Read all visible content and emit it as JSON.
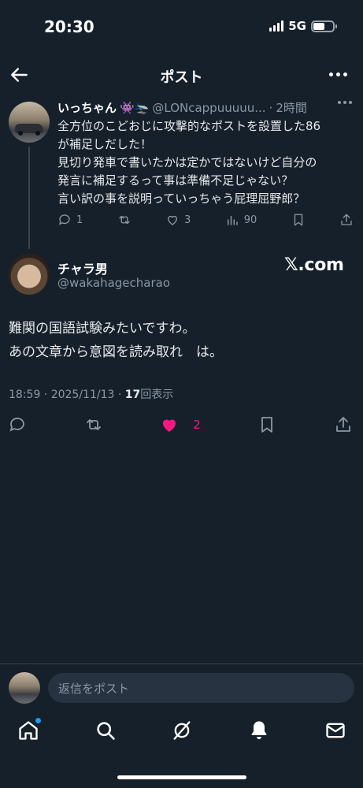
{
  "status_bar": {
    "time": "20:30",
    "network": "5G"
  },
  "header": {
    "title": "ポスト"
  },
  "parent_post": {
    "name": "いっちゃん",
    "name_emojis": "👾🛬",
    "handle": "@LONcappuuuuu...",
    "separator": "·",
    "time": "2時間",
    "lines": [
      "全方位のこどおじに攻撃的なポストを設置した86",
      "が補足しだした！",
      "見切り発車で書いたかは定かではないけど自分の",
      "発言に補足するって事は準備不足じゃない？",
      "言い訳の事を説明っていっちゃう屁理屈野郎？"
    ],
    "replies": "1",
    "likes": "3",
    "views": "90"
  },
  "main_post": {
    "name": "チャラ男",
    "handle": "@wakahagecharao",
    "watermark": "𝕏.com",
    "lines": [
      "難関の国語試験みたいですわ。",
      "あの文章から意図を読み取れ　は。"
    ],
    "timestamp": "18:59 · 2025/11/13 · ",
    "views_count": "17",
    "views_label": "回表示",
    "likes": "2"
  },
  "reply_bar": {
    "placeholder": "返信をポスト"
  },
  "colors": {
    "background": "#15202b",
    "accent": "#1d9bf0",
    "like": "#f91880",
    "muted": "#8b98a5"
  }
}
